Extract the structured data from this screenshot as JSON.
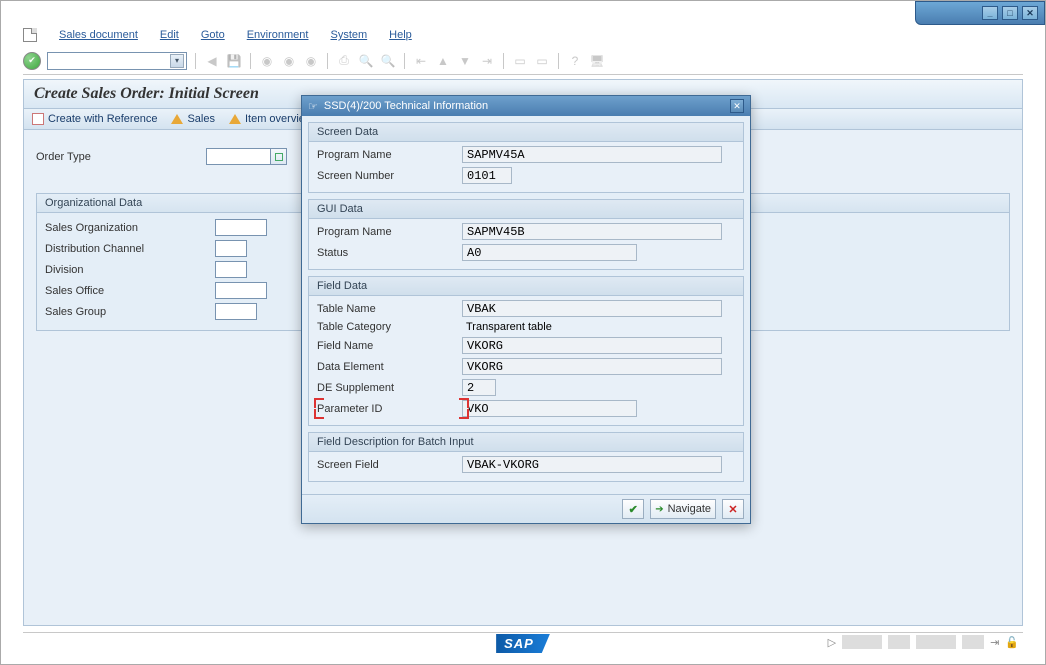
{
  "window": {
    "minimize": "_",
    "maximize": "□",
    "close": "✕"
  },
  "menu": {
    "sales_document": "Sales document",
    "edit": "Edit",
    "goto": "Goto",
    "environment": "Environment",
    "system": "System",
    "help": "Help"
  },
  "page_title": "Create Sales Order: Initial Screen",
  "app_toolbar": {
    "create_with_reference": "Create with Reference",
    "sales": "Sales",
    "item_overview": "Item overview"
  },
  "form": {
    "order_type_label": "Order Type",
    "org_data_title": "Organizational Data",
    "sales_org_label": "Sales Organization",
    "dist_channel_label": "Distribution Channel",
    "division_label": "Division",
    "sales_office_label": "Sales Office",
    "sales_group_label": "Sales Group"
  },
  "modal": {
    "title": "SSD(4)/200 Technical Information",
    "screen_data": {
      "title": "Screen Data",
      "program_name_label": "Program Name",
      "program_name": "SAPMV45A",
      "screen_number_label": "Screen Number",
      "screen_number": "0101"
    },
    "gui_data": {
      "title": "GUI Data",
      "program_name_label": "Program Name",
      "program_name": "SAPMV45B",
      "status_label": "Status",
      "status": "A0"
    },
    "field_data": {
      "title": "Field Data",
      "table_name_label": "Table Name",
      "table_name": "VBAK",
      "table_category_label": "Table Category",
      "table_category": "Transparent table",
      "field_name_label": "Field Name",
      "field_name": "VKORG",
      "data_element_label": "Data Element",
      "data_element": "VKORG",
      "de_supplement_label": "DE Supplement",
      "de_supplement": "2",
      "parameter_id_label": "Parameter ID",
      "parameter_id": "VKO"
    },
    "batch": {
      "title": "Field Description for Batch Input",
      "screen_field_label": "Screen Field",
      "screen_field": "VBAK-VKORG"
    },
    "footer": {
      "navigate": "Navigate",
      "cancel": "✕"
    }
  },
  "logo": "SAP"
}
